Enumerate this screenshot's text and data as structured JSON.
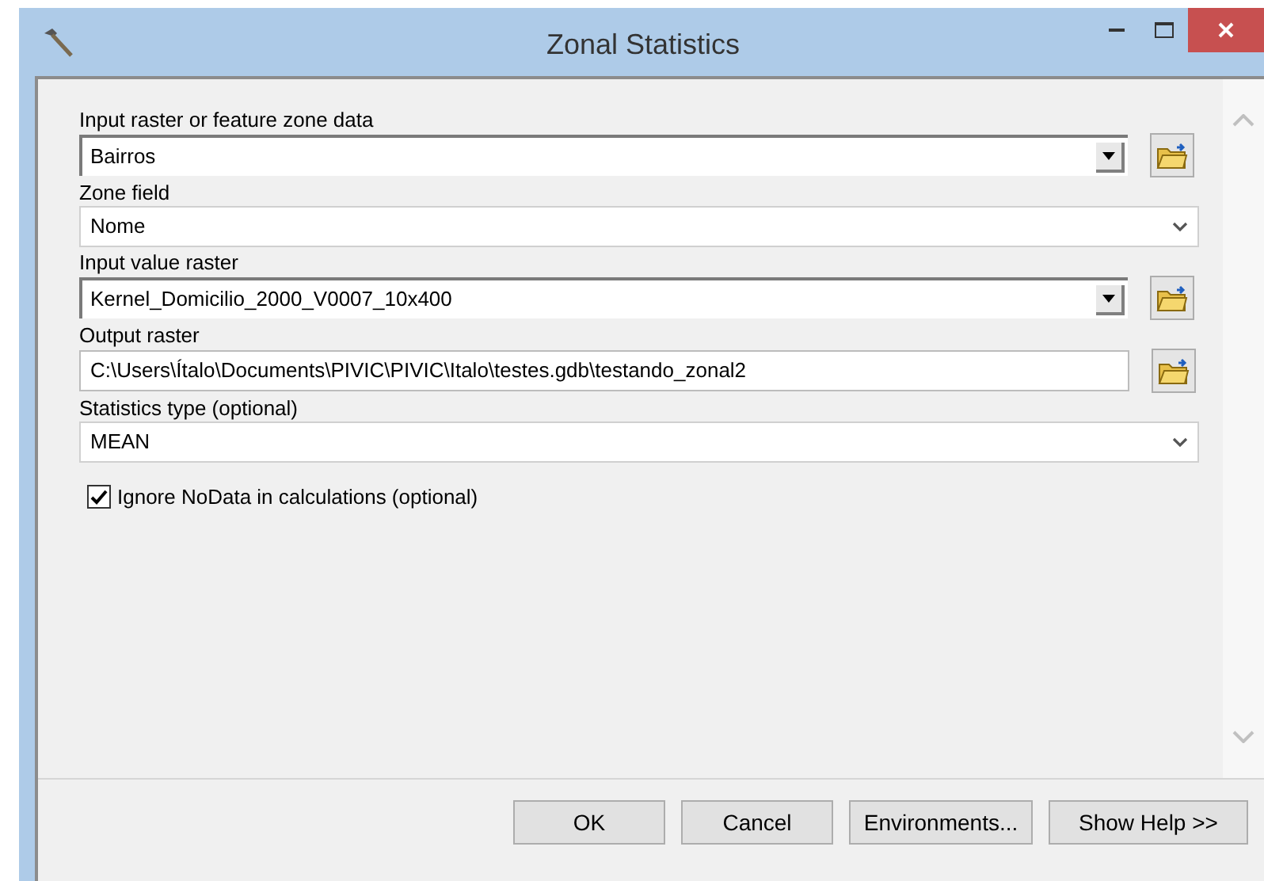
{
  "window": {
    "title": "Zonal Statistics"
  },
  "fields": [
    {
      "label": "Input raster or feature zone data",
      "value": "Bairros",
      "kind": "combo"
    },
    {
      "label": "Zone field",
      "value": "Nome",
      "kind": "select"
    },
    {
      "label": "Input value raster",
      "value": "Kernel_Domicilio_2000_V0007_10x400",
      "kind": "combo"
    },
    {
      "label": "Output raster",
      "value": "C:\\Users\\Ítalo\\Documents\\PIVIC\\PIVIC\\Italo\\testes.gdb\\testando_zonal2",
      "kind": "text"
    },
    {
      "label": "Statistics type (optional)",
      "value": "MEAN",
      "kind": "select"
    }
  ],
  "checkbox": {
    "label": "Ignore NoData in calculations (optional)",
    "checked": true
  },
  "buttons": [
    "OK",
    "Cancel",
    "Environments...",
    "Show Help >>"
  ]
}
